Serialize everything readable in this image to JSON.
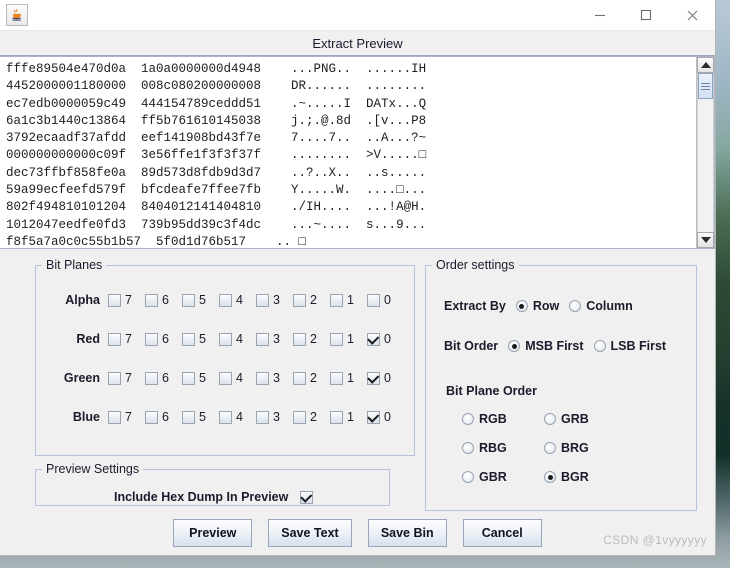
{
  "titlebar": {
    "app_icon": "java-coffee-cup-icon",
    "minimize_label": "—",
    "maximize_label": "❑",
    "close_label": "✕"
  },
  "dialog": {
    "title": "Extract Preview"
  },
  "hex_dump": {
    "lines": [
      "fffe89504e470d0a  1a0a0000000d4948    ...PNG..  ......IH",
      "4452000001180000  008c080200000008    DR......  ........",
      "ec7edb0000059c49  444154789ceddd51    .~.....I  DATx...Q",
      "6a1c3b1440c13864  ff5b761610145038    j.;.@.8d  .[v...P8",
      "3792ecaadf37afdd  eef141908bd43f7e    7....7..  ..A...?~",
      "000000000000c09f  3e56ffe1f3f3f37f    ........  >V.....□",
      "dec73ffbf858fe0a  89d573d8fdb9d3d7    ..?..X..  ..s.....",
      "59a99ecfeefd579f  bfcdeafe7ffee7fb    Y.....W.  ....□...",
      "802f494810101204  8404012141404810    ./IH....  ...!A@H.",
      "1012047eedfe0fd3  739b95dd39c3f4dc    ...~....  s...9...",
      "f8f5a7a0c0c55b1b57  5f0d1d76b517    .. □"
    ],
    "scrollbar": {
      "up_arrow": "scroll-up-arrow",
      "down_arrow": "scroll-down-arrow"
    }
  },
  "bit_planes": {
    "legend": "Bit Planes",
    "bit_labels": [
      "7",
      "6",
      "5",
      "4",
      "3",
      "2",
      "1",
      "0"
    ],
    "rows": [
      {
        "channel": "Alpha",
        "checked": [
          false,
          false,
          false,
          false,
          false,
          false,
          false,
          false
        ]
      },
      {
        "channel": "Red",
        "checked": [
          false,
          false,
          false,
          false,
          false,
          false,
          false,
          true
        ]
      },
      {
        "channel": "Green",
        "checked": [
          false,
          false,
          false,
          false,
          false,
          false,
          false,
          true
        ]
      },
      {
        "channel": "Blue",
        "checked": [
          false,
          false,
          false,
          false,
          false,
          false,
          false,
          true
        ]
      }
    ]
  },
  "order_settings": {
    "legend": "Order settings",
    "extract_by": {
      "label": "Extract By",
      "options": [
        "Row",
        "Column"
      ],
      "selected": "Row"
    },
    "bit_order": {
      "label": "Bit Order",
      "options": [
        "MSB First",
        "LSB First"
      ],
      "selected": "MSB First"
    },
    "bit_plane_order": {
      "label": "Bit Plane Order",
      "options": [
        "RGB",
        "GRB",
        "RBG",
        "BRG",
        "GBR",
        "BGR"
      ],
      "selected": "BGR"
    }
  },
  "preview_settings": {
    "legend": "Preview Settings",
    "include_hex_dump": {
      "label": "Include Hex Dump In Preview",
      "checked": true
    }
  },
  "buttons": [
    {
      "label": "Preview"
    },
    {
      "label": "Save Text"
    },
    {
      "label": "Save Bin"
    },
    {
      "label": "Cancel"
    }
  ],
  "watermark": {
    "text": "CSDN @1vyyyyyy"
  }
}
